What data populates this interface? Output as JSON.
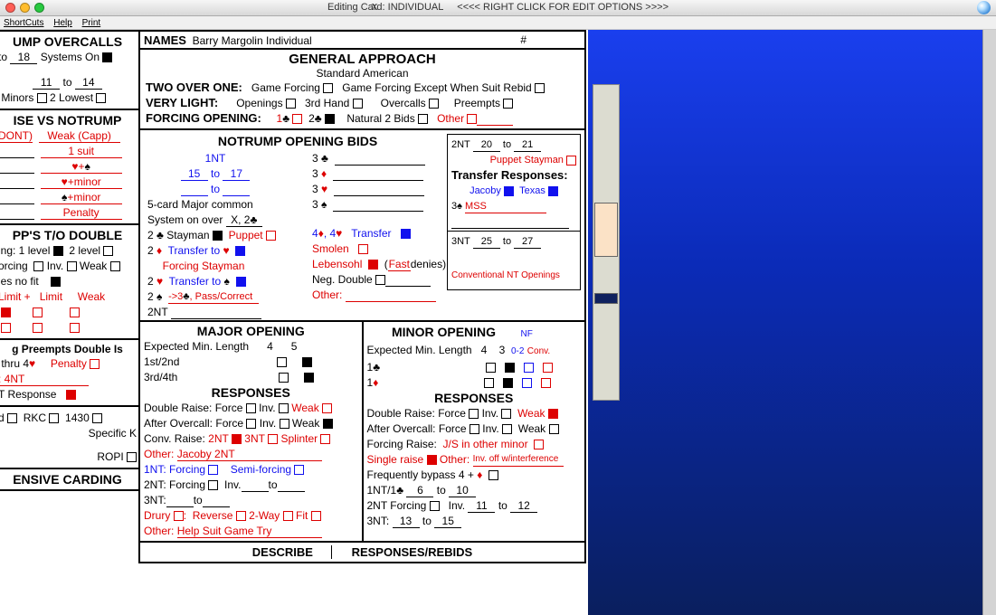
{
  "window": {
    "title": "Editing Card: INDIVIDUAL",
    "hint": "<<<< RIGHT CLICK FOR EDIT OPTIONS >>>>"
  },
  "menu": {
    "shortcuts": "ShortCuts",
    "help": "Help",
    "print": "Print"
  },
  "names": {
    "label": "NAMES",
    "value": "Barry Margolin Individual",
    "hash": "#"
  },
  "left": {
    "oc": {
      "title": "UMP OVERCALLS",
      "to": "to",
      "v1": "18",
      "sys": "Systems On",
      "v2": "11",
      "v3": "14",
      "minors": "Minors",
      "lowest": "2 Lowest"
    },
    "nt": {
      "title": "ISE VS NOTRUMP",
      "dont": "DONT)",
      "wc": "Weak (Capp)",
      "s1": "1 suit",
      "s2": "♥+♠",
      "s3": "♥+minor",
      "s4": "♠+minor",
      "pen": "Penalty"
    },
    "to": {
      "title": "PP'S T/O DOUBLE",
      "l1": "ing:  1 level",
      "l2": "2 level",
      "orc": "orcing",
      "inv": "Inv.",
      "weak": "Weak",
      "nf": "ies no fit",
      "lp": "Limit +",
      "lim": "Limit",
      "wk": "Weak"
    },
    "pre": {
      "title": "g Preempts Double Is",
      "thru": "thru 4",
      "pen": "Penalty",
      "fnt": "4NT",
      "tr": "T Response"
    },
    "misc": {
      "rkc": "RKC",
      "v1430": "1430",
      "spk": "Specific K",
      "ropi": "ROPI"
    },
    "card": {
      "title": "ENSIVE CARDING"
    }
  },
  "ga": {
    "title": "GENERAL APPROACH",
    "sub": "Standard American",
    "t21": "TWO OVER ONE:",
    "gf": "Game Forcing",
    "gfe": "Game Forcing Except When Suit Rebid",
    "vl": "VERY LIGHT:",
    "op": "Openings",
    "h3": "3rd Hand",
    "oc": "Overcalls",
    "pr": "Preempts",
    "fo": "FORCING OPENING:",
    "c1": "1",
    "c2": "2",
    "n2": "Natural 2 Bids",
    "oth": "Other"
  },
  "nt": {
    "title": "NOTRUMP OPENING BIDS",
    "nt1": "1NT",
    "to": "to",
    "v15": "15",
    "v17": "17",
    "fcm": "5-card Major common",
    "soo": "System on over",
    "x2c": "X, 2♣",
    "stay": "Stayman",
    "pup": "Puppet",
    "tth": "Transfer to ♥",
    "fst": "Forcing Stayman",
    "tts": "Transfer to ♠",
    "s23": "->3♣, Pass/Correct",
    "nt2l": "2NT",
    "c44": "4♦, 4♥",
    "tr": "Transfer",
    "smo": "Smolen",
    "leb": "Lebensohl",
    "fast": "Fast",
    "den": "denies)",
    "nd": "Neg. Double",
    "oth": "Other:",
    "sub": {
      "nt2": "2NT",
      "v20": "20",
      "v21": "21",
      "ps": "Puppet Stayman",
      "trr": "Transfer Responses:",
      "jac": "Jacoby",
      "tex": "Texas",
      "c3s": "3",
      "mss": "MSS",
      "nt3": "3NT",
      "v25": "25",
      "v27": "27",
      "cno": "Conventional NT Openings"
    }
  },
  "maj": {
    "title": "MAJOR OPENING",
    "eml": "Expected Min. Length",
    "c4": "4",
    "c5": "5",
    "r12": "1st/2nd",
    "r34": "3rd/4th",
    "resp": "RESPONSES",
    "dr": "Double Raise:",
    "fo": "Force",
    "inv": "Inv.",
    "wk": "Weak",
    "ao": "After Overcall:",
    "cr": "Conv. Raise:",
    "c2nt": "2NT",
    "c3nt": "3NT",
    "spl": "Splinter",
    "oth": "Other:",
    "j2nt": "Jacoby 2NT",
    "nt1": "1NT:",
    "frc": "Forcing",
    "sem": "Semi-forcing",
    "nt2": "2NT: Forcing",
    "nt3": "3NT:",
    "to": "to",
    "dru": "Drury",
    "rev": "Reverse",
    "w2": "2-Way",
    "fit": "Fit",
    "hsgt": "Help Suit Game Try"
  },
  "min": {
    "title": "MINOR OPENING",
    "nf": "NF",
    "z02": "0-2",
    "conv": "Conv.",
    "eml": "Expected Min. Length",
    "c4": "4",
    "c3": "3",
    "c1c": "1",
    "c1d": "1",
    "resp": "RESPONSES",
    "dr": "Double Raise:",
    "fo": "Force",
    "inv": "Inv.",
    "wk": "Weak",
    "ao": "After Overcall:",
    "fr": "Forcing Raise:",
    "jsi": "J/S in other minor",
    "sr": "Single raise",
    "oth": "Other:",
    "ioi": "Inv. off w/interference",
    "fb": "Frequently bypass 4 + ",
    "n1nt": "1NT/1",
    "v6": "6",
    "v10": "10",
    "to": "to",
    "n2nt": "2NT Forcing",
    "v11": "11",
    "v12": "12",
    "n3nt": "3NT:",
    "v13": "13",
    "v15": "15"
  },
  "tabs": {
    "desc": "DESCRIBE",
    "rr": "RESPONSES/REBIDS"
  }
}
